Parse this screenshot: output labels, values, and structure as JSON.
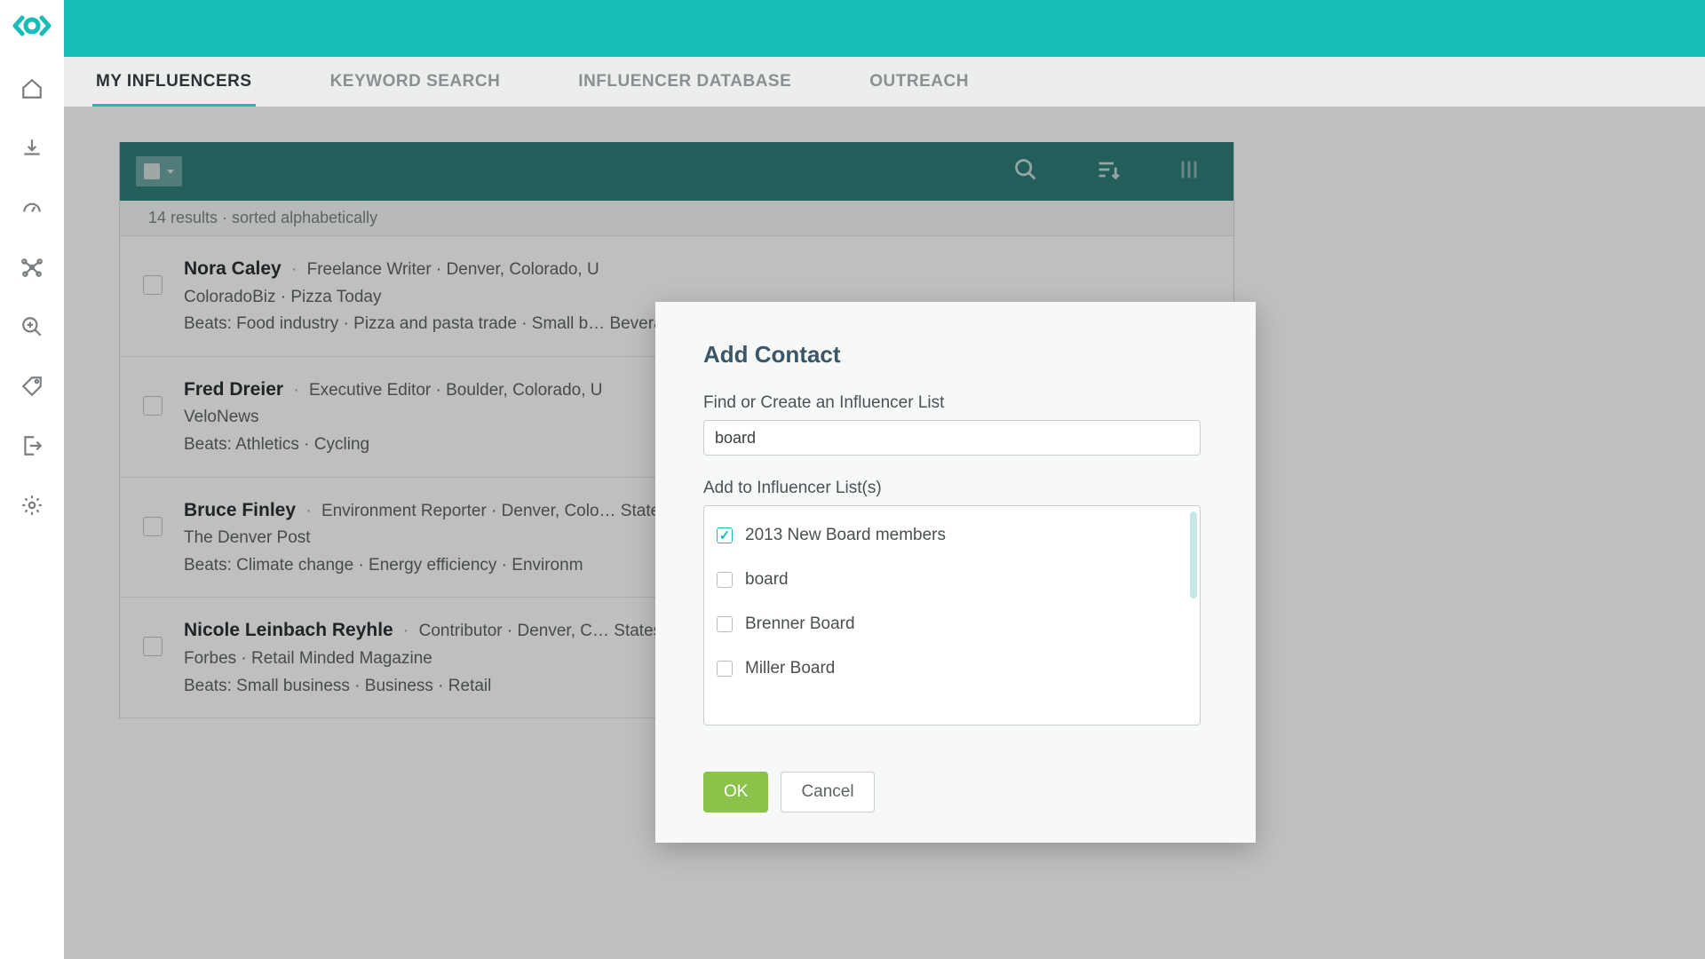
{
  "tabs": [
    {
      "label": "MY INFLUENCERS",
      "active": true
    },
    {
      "label": "KEYWORD SEARCH",
      "active": false
    },
    {
      "label": "INFLUENCER DATABASE",
      "active": false
    },
    {
      "label": "OUTREACH",
      "active": false
    }
  ],
  "results": {
    "meta": "14 results · sorted alphabetically",
    "rows": [
      {
        "name": "Nora Caley",
        "role_loc": "Freelance Writer · Denver, Colorado, U",
        "org": "ColoradoBiz · Pizza Today",
        "beats": "Beats: Food industry · Pizza and pasta trade · Small b… Beverage"
      },
      {
        "name": "Fred Dreier",
        "role_loc": "Executive Editor · Boulder, Colorado, U",
        "org": "VeloNews",
        "beats": "Beats: Athletics · Cycling"
      },
      {
        "name": "Bruce Finley",
        "role_loc": "Environment Reporter · Denver, Colo… States",
        "org": "The Denver Post",
        "beats": "Beats: Climate change · Energy efficiency · Environm"
      },
      {
        "name": "Nicole Leinbach Reyhle",
        "role_loc": "Contributor · Denver, C… States",
        "org": "Forbes · Retail Minded Magazine",
        "beats": "Beats: Small business · Business · Retail"
      }
    ]
  },
  "modal": {
    "title": "Add Contact",
    "find_label": "Find or Create an Influencer List",
    "find_value": "board",
    "add_label": "Add to Influencer List(s)",
    "options": [
      {
        "label": "2013 New Board members",
        "checked": true
      },
      {
        "label": "board",
        "checked": false
      },
      {
        "label": "Brenner Board",
        "checked": false
      },
      {
        "label": "Miller Board",
        "checked": false
      }
    ],
    "ok": "OK",
    "cancel": "Cancel"
  }
}
